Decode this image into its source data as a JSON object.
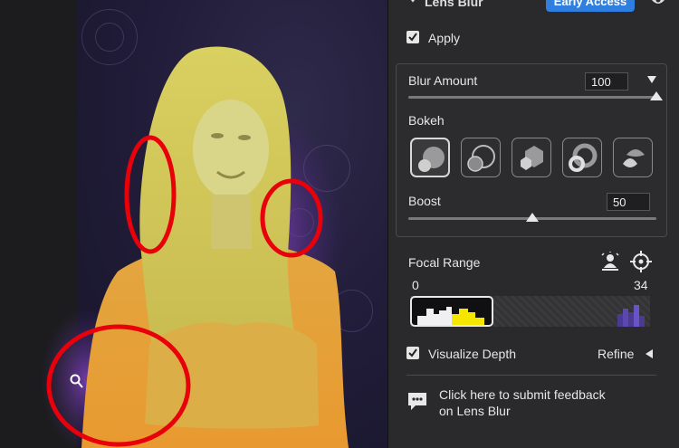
{
  "panel": {
    "header_title": "Lens Blur",
    "badge": "Early Access",
    "apply_label": "Apply",
    "blur_amount_label": "Blur Amount",
    "blur_amount_value": "100",
    "blur_amount_level": 1.0,
    "bokeh_label": "Bokeh",
    "bokeh_shapes": [
      "circle",
      "ring",
      "hexagon",
      "donut",
      "cat-eye"
    ],
    "bokeh_selected": "circle",
    "boost_label": "Boost",
    "boost_value": "50",
    "boost_level": 0.5,
    "focal_range_label": "Focal Range",
    "focal_min": "0",
    "focal_max": "34",
    "visualize_depth_label": "Visualize Depth",
    "refine_label": "Refine",
    "feedback_text_1": "Click here to submit feedback",
    "feedback_text_2": "on Lens Blur",
    "icons": [
      "chevron-down-icon",
      "eye-icon",
      "checkmark-icon",
      "dropdown-triangle-icon",
      "person-focus-icon",
      "crosshair-icon",
      "chevron-left-icon",
      "feedback-icon"
    ]
  },
  "colors": {
    "accent_blue": "#2f7fe0",
    "annotation_red": "#e8000a",
    "depth_yellow": "#e6e05a",
    "depth_orange": "#e4a23a",
    "background_purple": "#3b2d6e"
  }
}
